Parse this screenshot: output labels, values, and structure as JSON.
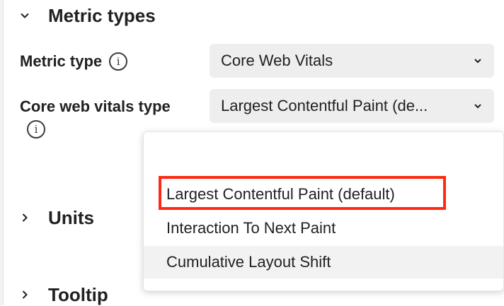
{
  "sections": {
    "metric_types": "Metric types",
    "units": "Units",
    "tooltip": "Tooltip"
  },
  "fields": {
    "metric_type": {
      "label": "Metric type",
      "value": "Core Web Vitals"
    },
    "core_web_vitals_type": {
      "label": "Core web vitals type",
      "value": "Largest Contentful Paint (de..."
    }
  },
  "dropdown": {
    "options": [
      "Largest Contentful Paint (default)",
      "Interaction To Next Paint",
      "Cumulative Layout Shift"
    ],
    "hovered_option": "Cumulative Layout Shift",
    "highlighted_option": "Largest Contentful Paint (default)"
  },
  "colors": {
    "highlight_border": "#ff2a12",
    "select_background": "#eeeeee"
  },
  "icons": {
    "info": "info-icon",
    "expanded": "chevron-down-icon",
    "collapsed": "chevron-right-icon",
    "select": "chevron-down-icon"
  }
}
